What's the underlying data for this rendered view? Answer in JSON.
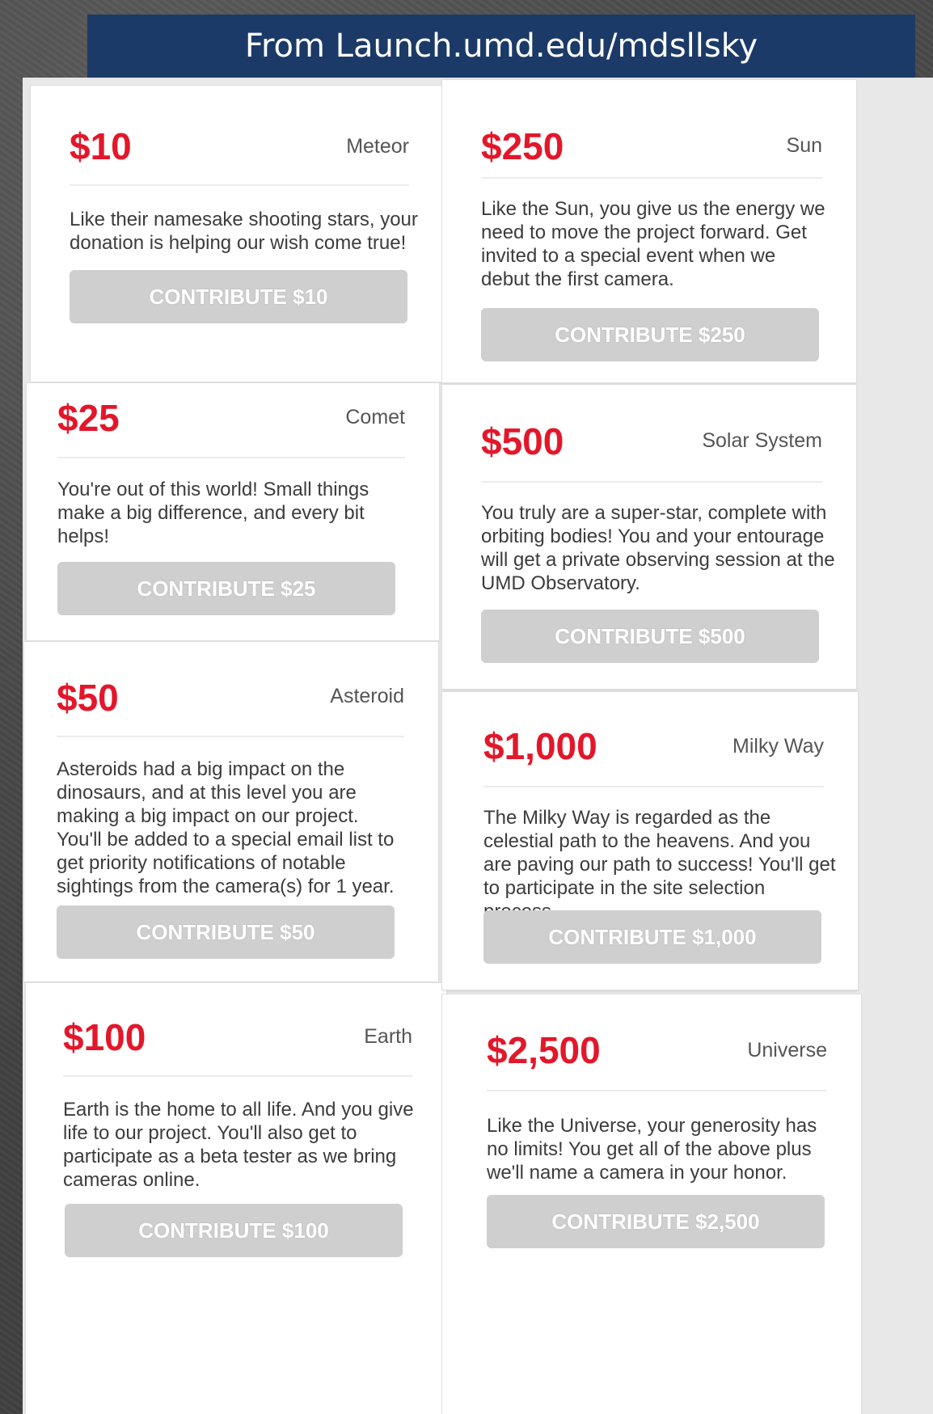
{
  "banner": {
    "text": "From Launch.umd.edu/mdsllsky"
  },
  "accent_color": "#e3172a",
  "button_color": "#cfcfcf",
  "rewards": [
    {
      "price": "$10",
      "tier": "Meteor",
      "description": "Like their namesake shooting stars, your donation is helping our wish come true!",
      "button_label": "CONTRIBUTE $10"
    },
    {
      "price": "$25",
      "tier": "Comet",
      "description": "You're out of this world! Small things make a big difference, and every bit helps!",
      "button_label": "CONTRIBUTE $25"
    },
    {
      "price": "$50",
      "tier": "Asteroid",
      "description": "Asteroids had a big impact on the dinosaurs, and at this level you are making a big impact on our project. You'll be added to a special email list to get priority notifications of notable sightings from the camera(s) for 1 year.",
      "button_label": "CONTRIBUTE $50"
    },
    {
      "price": "$100",
      "tier": "Earth",
      "description": "Earth is the home to all life. And you give life to our project. You'll also get to participate as a beta tester as we bring cameras online.",
      "button_label": "CONTRIBUTE $100"
    },
    {
      "price": "$250",
      "tier": "Sun",
      "description": "Like the Sun, you give us the energy we need to move the project forward. Get invited to a special event when we debut the first camera.",
      "button_label": "CONTRIBUTE $250"
    },
    {
      "price": "$500",
      "tier": "Solar System",
      "description": "You truly are a super-star, complete with orbiting bodies! You and your entourage will get a private observing session at the UMD Observatory.",
      "button_label": "CONTRIBUTE $500"
    },
    {
      "price": "$1,000",
      "tier": "Milky Way",
      "description": "The Milky Way is regarded as the celestial path to the heavens. And you are paving our path to success! You'll get to participate in the site selection process.",
      "button_label": "CONTRIBUTE $1,000"
    },
    {
      "price": "$2,500",
      "tier": "Universe",
      "description": "Like the Universe, your generosity has no limits! You get all of the above plus we'll name a camera in your honor.",
      "button_label": "CONTRIBUTE $2,500"
    }
  ]
}
